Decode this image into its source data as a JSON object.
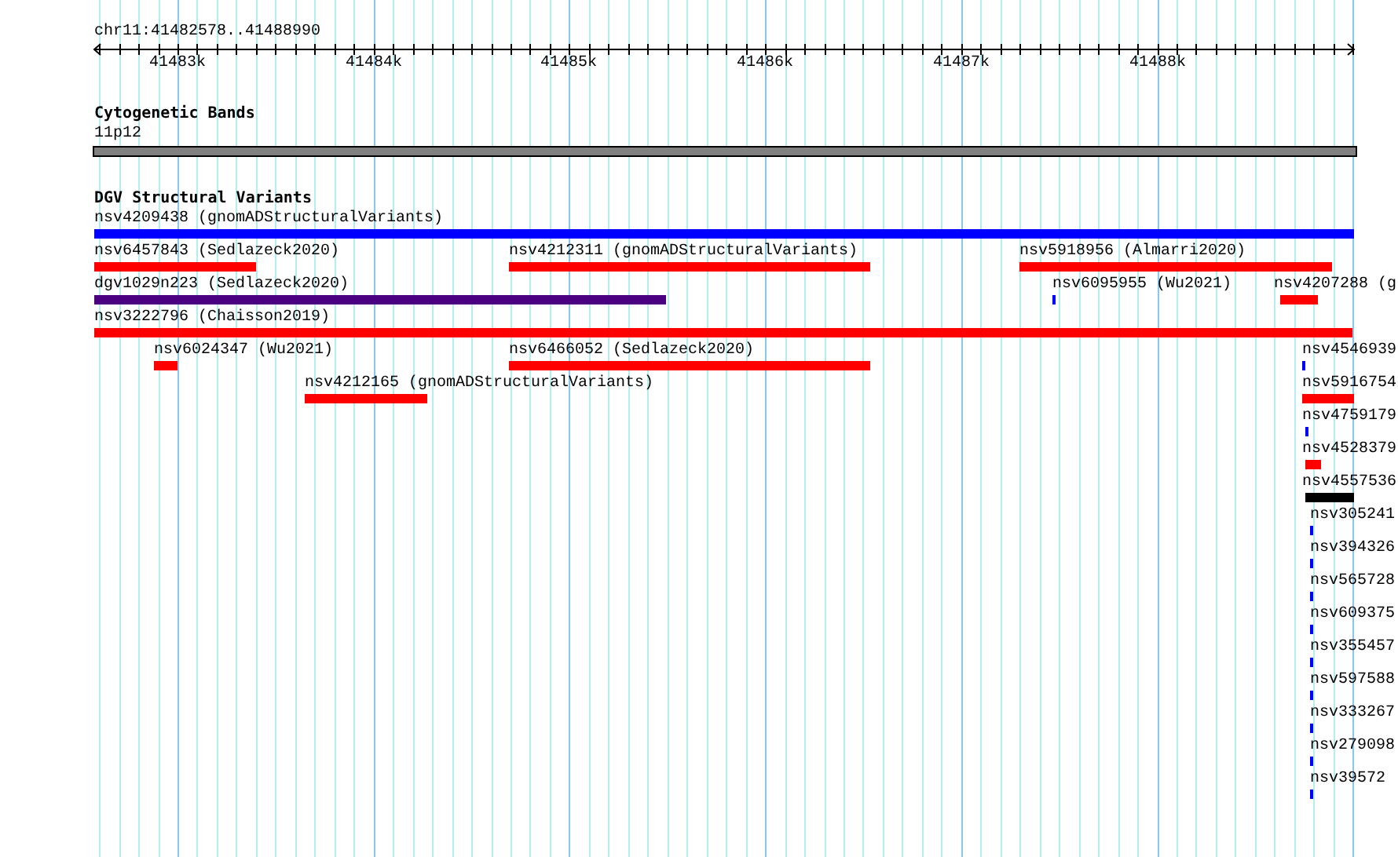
{
  "ruler": {
    "region": "chr11:41482578..41488990",
    "ticks": [
      "41483k",
      "41484k",
      "41485k",
      "41486k",
      "41487k",
      "41488k"
    ]
  },
  "tracks": [
    {
      "title": "Cytogenetic Bands",
      "kind": "bands",
      "features": [
        {
          "label": "11p12",
          "color": "#808080"
        }
      ]
    },
    {
      "title": "DGV Structural Variants",
      "kind": "variants",
      "features": [
        {
          "label": "nsv4209438 (gnomADStructuralVariants)",
          "color": "#0000ff"
        },
        {
          "label": "nsv6457843 (Sedlazeck2020)",
          "color": "#ff0000"
        },
        {
          "label": "nsv4212311 (gnomADStructuralVariants)",
          "color": "#ff0000"
        },
        {
          "label": "nsv5918956 (Almarri2020)",
          "color": "#ff0000"
        },
        {
          "label": "dgv1029n223 (Sedlazeck2020)",
          "color": "#4b0082"
        },
        {
          "label": "nsv6095955 (Wu2021)",
          "color": "#0000ff"
        },
        {
          "label": "nsv4207288 (g",
          "color": "#ff0000"
        },
        {
          "label": "nsv3222796 (Chaisson2019)",
          "color": "#ff0000"
        },
        {
          "label": "nsv6024347 (Wu2021)",
          "color": "#ff0000"
        },
        {
          "label": "nsv6466052 (Sedlazeck2020)",
          "color": "#ff0000"
        },
        {
          "label": "nsv4546939",
          "color": "#0000ff"
        },
        {
          "label": "nsv4212165 (gnomADStructuralVariants)",
          "color": "#ff0000"
        },
        {
          "label": "nsv5916754",
          "color": "#ff0000"
        },
        {
          "label": "nsv4759179",
          "color": "#0000ff"
        },
        {
          "label": "nsv4528379",
          "color": "#ff0000"
        },
        {
          "label": "nsv4557536",
          "color": "#000000"
        },
        {
          "label": "nsv305241",
          "color": "#0000ff"
        },
        {
          "label": "nsv394326",
          "color": "#0000ff"
        },
        {
          "label": "nsv565728",
          "color": "#0000ff"
        },
        {
          "label": "nsv609375",
          "color": "#0000ff"
        },
        {
          "label": "nsv355457",
          "color": "#0000ff"
        },
        {
          "label": "nsv597588",
          "color": "#0000ff"
        },
        {
          "label": "nsv333267",
          "color": "#0000ff"
        },
        {
          "label": "nsv279098",
          "color": "#0000ff"
        },
        {
          "label": "nsv39572",
          "color": "#0000ff"
        }
      ]
    }
  ]
}
